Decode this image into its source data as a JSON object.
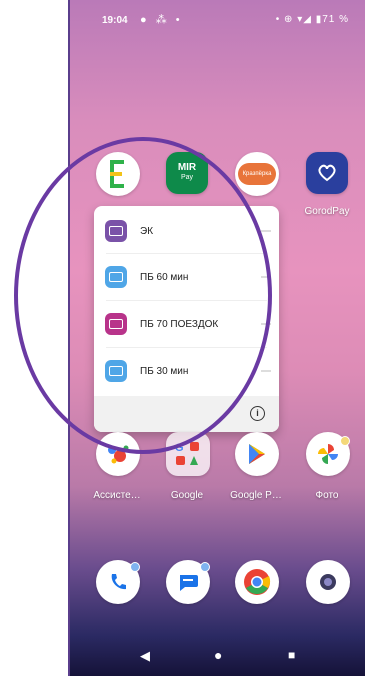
{
  "status_bar": {
    "time": "19:04",
    "notifications": "● ⁂ •",
    "system": "• ⊕ ▾◢ ▮71 %"
  },
  "apps_row1": [
    {
      "label": "",
      "icon": "e-app-icon"
    },
    {
      "label": "",
      "icon": "mir-pay-icon",
      "text": "MIR",
      "subtext": "Pay"
    },
    {
      "label": "",
      "icon": "yurtopka-icon",
      "text": "Кразпёрка"
    },
    {
      "label": "GorodPay",
      "icon": "gorodpay-icon"
    }
  ],
  "shortcut_menu": {
    "items": [
      {
        "label": "ЭК",
        "color": "#7a52a8"
      },
      {
        "label": "ПБ 60 мин",
        "color": "#4fa6e7"
      },
      {
        "label": "ПБ 70 ПОЕЗДОК",
        "color": "#b8338a"
      },
      {
        "label": "ПБ 30 мин",
        "color": "#4fa6e7"
      }
    ],
    "info": "i"
  },
  "apps_row2": [
    {
      "label": "Ассисте…",
      "icon": "assistant-icon"
    },
    {
      "label": "Google",
      "icon": "google-folder-icon"
    },
    {
      "label": "Google P…",
      "icon": "google-play-icon"
    },
    {
      "label": "Фото",
      "icon": "photos-icon"
    }
  ],
  "dock": [
    {
      "icon": "phone-icon"
    },
    {
      "icon": "messages-icon"
    },
    {
      "icon": "chrome-icon"
    },
    {
      "icon": "camera-icon"
    }
  ],
  "nav": {
    "back": "◀",
    "home": "●",
    "recents": "■"
  },
  "colors": {
    "annotation_oval": "#6a3aa3"
  }
}
